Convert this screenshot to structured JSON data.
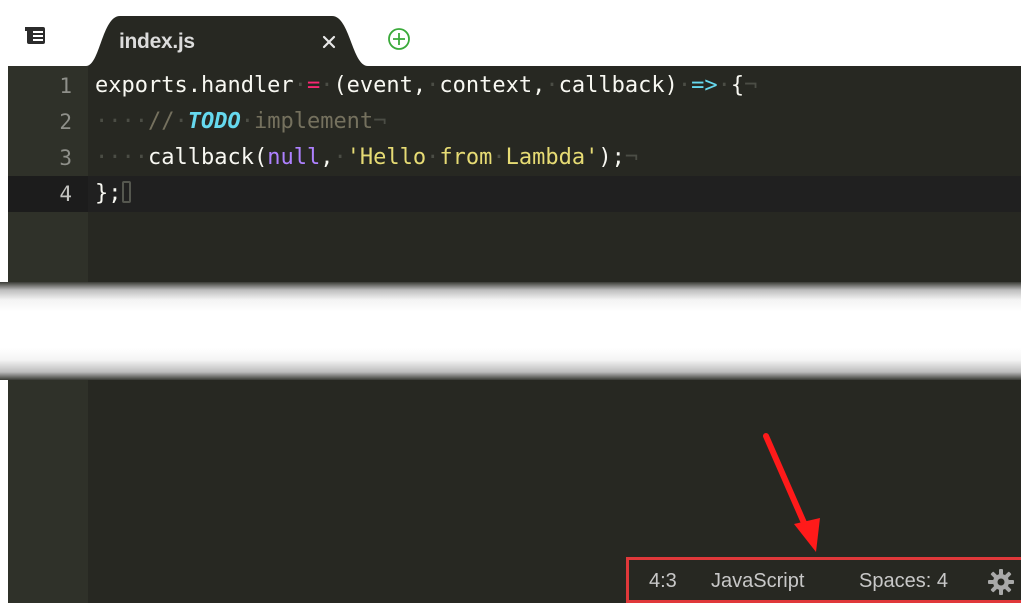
{
  "tab": {
    "title": "index.js",
    "close_glyph": "×"
  },
  "code_lines": [
    {
      "num": "1",
      "segments": []
    },
    {
      "num": "2",
      "segments": []
    },
    {
      "num": "3",
      "segments": []
    },
    {
      "num": "4",
      "segments": []
    }
  ],
  "code": {
    "line1": {
      "a": "exports.handler",
      "eq": "=",
      "b": "(event,",
      "c": "context,",
      "d": "callback)",
      "arrow": "=>",
      "brace": "{",
      "eol": "¬"
    },
    "line2": {
      "ws": "····",
      "slashes": "//",
      "todo": "TODO",
      "rest": "implement",
      "eol": "¬"
    },
    "line3": {
      "ws": "····",
      "call": "callback(",
      "null": "null",
      "comma": ",",
      "str_q1": "'Hello",
      "str_q2": "from",
      "str_q3": "Lambda'",
      "close": ");",
      "eol": "¬"
    },
    "line4": {
      "text": "};",
      "pilcrow": "¶"
    }
  },
  "status_bar": {
    "position": "4:3",
    "language": "JavaScript",
    "spaces": "Spaces: 4",
    "highlight_color": "#e0383a"
  },
  "icons": {
    "file_menu": "file-list-icon",
    "add_tab": "plus-circle-icon",
    "settings": "gear-icon",
    "annotation": "red-arrow-icon"
  },
  "colors": {
    "editor_bg": "#272822",
    "gutter_bg": "#2f3129",
    "keyword": "#ae81ff",
    "string": "#e6db74",
    "operator": "#f92672",
    "accent": "#66d9ef"
  }
}
